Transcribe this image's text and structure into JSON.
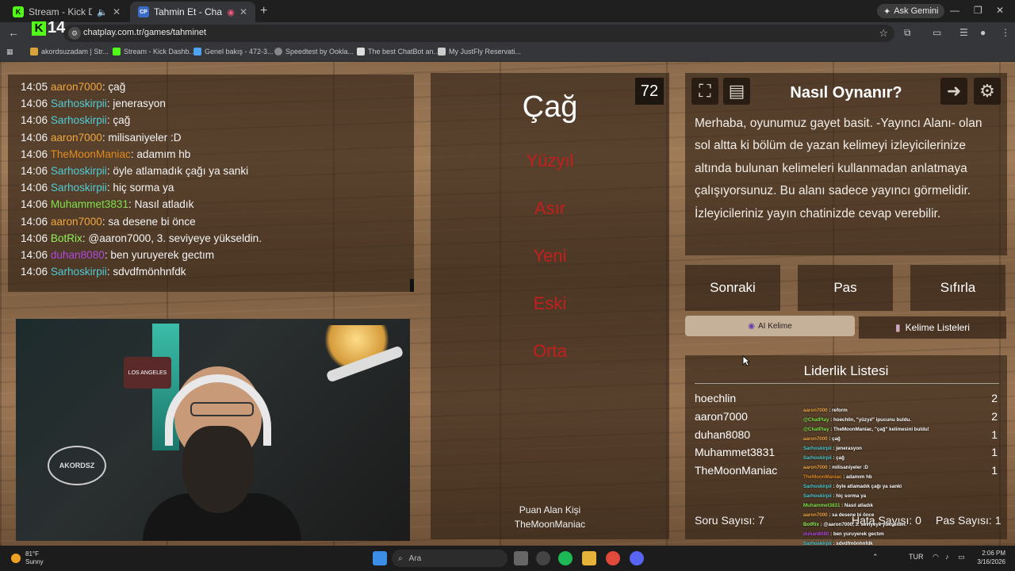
{
  "browser": {
    "tabs": [
      {
        "title": "Stream - Kick Dashboard",
        "favicon": "K",
        "color": "#53fc18"
      },
      {
        "title": "Tahmin Et - ChatPlay",
        "favicon": "CP",
        "color": "#3a6cc7"
      }
    ],
    "gemini_label": "Ask Gemini",
    "url": "chatplay.com.tr/games/tahminet",
    "overlay_badge": "14",
    "bookmarks": [
      "akordsuzadam | Str...",
      "Stream - Kick Dashb...",
      "Genel bakış - 472-3...",
      "Speedtest by Ookla...",
      "The best ChatBot an...",
      "My JustFly Reservati..."
    ]
  },
  "chat": {
    "messages": [
      {
        "time": "14:05",
        "user": "aaron7000",
        "color": "#f0a640",
        "text": ": çağ"
      },
      {
        "time": "14:06",
        "user": "Sarhoskirpii",
        "color": "#4ecbd3",
        "text": ": jenerasyon"
      },
      {
        "time": "14:06",
        "user": "Sarhoskirpii",
        "color": "#4ecbd3",
        "text": ": çağ"
      },
      {
        "time": "14:06",
        "user": "aaron7000",
        "color": "#f0a640",
        "text": ": milisaniyeler :D"
      },
      {
        "time": "14:06",
        "user": "TheMoonManiac",
        "color": "#e08a20",
        "text": ": adamım hb"
      },
      {
        "time": "14:06",
        "user": "Sarhoskirpii",
        "color": "#4ecbd3",
        "text": ": öyle atlamadık çağı ya sanki"
      },
      {
        "time": "14:06",
        "user": "Sarhoskirpii",
        "color": "#4ecbd3",
        "text": ": hiç sorma ya"
      },
      {
        "time": "14:06",
        "user": "Muhammet3831",
        "color": "#7ee04a",
        "text": ": Nasıl atladık"
      },
      {
        "time": "14:06",
        "user": "aaron7000",
        "color": "#f0a640",
        "text": ": sa desene bi önce"
      },
      {
        "time": "14:06",
        "user": "BotRix",
        "color": "#8ef05a",
        "text": ": @aaron7000, 3. seviyeye yükseldin."
      },
      {
        "time": "14:06",
        "user": "duhan8080",
        "color": "#b04ae0",
        "text": ": ben yuruyerek gectım"
      },
      {
        "time": "14:06",
        "user": "Sarhoskirpii",
        "color": "#4ecbd3",
        "text": ": sdvdfmönhnfdk"
      }
    ]
  },
  "webcam": {
    "sign_text": "LOS ANGELES",
    "logo_text": "AKORDSZ"
  },
  "game": {
    "timer": "72",
    "word": "Çağ",
    "taboo_words": [
      "Yüzyıl",
      "Asır",
      "Yeni",
      "Eski",
      "Orta"
    ],
    "scorer_label": "Puan Alan Kişi",
    "scorer_name": "TheMoonManiac",
    "taboo_color": "#c41e1e"
  },
  "info": {
    "title": "Nasıl Oynanır?",
    "description": "Merhaba, oyunumuz gayet basit. -Yayıncı Alanı- olan sol altta ki bölüm de yazan kelimeyi izleyicilerinize altında bulunan kelimeleri kullanmadan anlatmaya çalışıyorsunuz. Bu alanı sadece yayıncı görmelidir. İzleyicileriniz yayın chatinizde cevap verebilir."
  },
  "controls": {
    "next": "Sonraki",
    "pass": "Pas",
    "reset": "Sıfırla",
    "ai_word": "AI Kelime",
    "word_lists": "Kelime Listeleri"
  },
  "leaderboard": {
    "title": "Liderlik Listesi",
    "rows": [
      {
        "name": "hoechlin",
        "score": "2"
      },
      {
        "name": "aaron7000",
        "score": "2"
      },
      {
        "name": "duhan8080",
        "score": "1"
      },
      {
        "name": "Muhammet3831",
        "score": "1"
      },
      {
        "name": "TheMoonManiac",
        "score": "1"
      }
    ],
    "question_count": "Soru Sayısı: 7",
    "error_count": "Hata Sayısı: 0",
    "pass_count": "Pas Sayısı: 1"
  },
  "overlay_chat": [
    {
      "user": "aaron7000",
      "color": "#f0a640",
      "text": " : reform"
    },
    {
      "user": "@ChatPlay",
      "color": "#7ee04a",
      "text": " : hoechlin, \"yüzyıl\" ipucunu buldu."
    },
    {
      "user": "@ChatPlay",
      "color": "#7ee04a",
      "text": " : TheMoonManiac, \"çağ\" kelimesini buldu!"
    },
    {
      "user": "aaron7000",
      "color": "#f0a640",
      "text": " : çağ"
    },
    {
      "user": "Sarhoskirpii",
      "color": "#4ecbd3",
      "text": " : jenerasyon"
    },
    {
      "user": "Sarhoskirpii",
      "color": "#4ecbd3",
      "text": " : çağ"
    },
    {
      "user": "aaron7000",
      "color": "#f0a640",
      "text": " : milisaniyeler :D"
    },
    {
      "user": "TheMoonManiac",
      "color": "#e08a20",
      "text": " : adamım hb"
    },
    {
      "user": "Sarhoskirpii",
      "color": "#4ecbd3",
      "text": " : öyle atlamadık çağı ya sanki"
    },
    {
      "user": "Sarhoskirpii",
      "color": "#4ecbd3",
      "text": " : hiç sorma ya"
    },
    {
      "user": "Muhammet3831",
      "color": "#7ee04a",
      "text": " : Nasıl atladık"
    },
    {
      "user": "aaron7000",
      "color": "#f0a640",
      "text": " : sa desene bi önce"
    },
    {
      "user": "BotRix",
      "color": "#8ef05a",
      "text": " : @aaron7000, 3. seviyeye yükseldin."
    },
    {
      "user": "duhan8080",
      "color": "#b04ae0",
      "text": " : ben yuruyerek gectım"
    },
    {
      "user": "Sarhoskirpii",
      "color": "#4ecbd3",
      "text": " : sdvdfmönhnfdk"
    }
  ],
  "taskbar": {
    "weather_temp": "81°F",
    "weather_desc": "Sunny",
    "search_placeholder": "Ara",
    "lang": "TUR",
    "time": "2:06 PM",
    "date": "3/16/2026"
  }
}
